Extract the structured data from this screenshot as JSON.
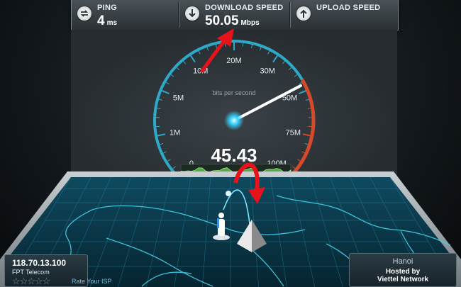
{
  "stats": {
    "ping": {
      "label": "PING",
      "value": "4",
      "unit": "ms",
      "icon": "ping-arrows-icon"
    },
    "download": {
      "label": "DOWNLOAD SPEED",
      "value": "50.05",
      "unit": "Mbps",
      "icon": "download-arrow-icon"
    },
    "upload": {
      "label": "UPLOAD SPEED",
      "icon": "upload-arrow-icon"
    }
  },
  "gauge": {
    "caption": "bits per second",
    "current_reading": "45.43",
    "needle_value_mbps": 47,
    "tick_labels": [
      "0",
      "1M",
      "5M",
      "10M",
      "20M",
      "30M",
      "50M",
      "75M",
      "100M"
    ],
    "colors": {
      "scale": "#2fa9c8",
      "redline": "#d64a2a",
      "needle": "#ffffff",
      "sparkline": "#5bbf4a"
    }
  },
  "client": {
    "ip": "118.70.13.100",
    "isp": "FPT Telecom",
    "rating_stars": 5,
    "rate_label": "Rate Your ISP"
  },
  "server": {
    "city": "Hanoi",
    "hosted_by": "Hosted by",
    "network": "Viettel Network"
  },
  "annotations": {
    "arrow_color": "#e8121a"
  }
}
